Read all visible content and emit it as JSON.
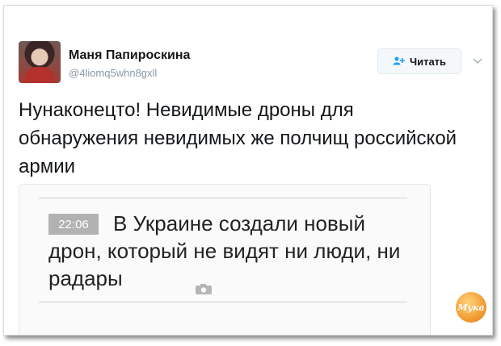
{
  "tweet": {
    "author_name": "Маня Папироскина",
    "author_handle": "@4liomq5whn8gxll",
    "follow_label": "Читать",
    "text": "Нунаконецто! Невидимые дроны для обнаружения невидимых же полчищ российской армии"
  },
  "card": {
    "time": "22:06",
    "headline": "В Украине создали новый дрон, который не видят ни люди, ни радары"
  },
  "watermark": {
    "label": "Мука"
  },
  "colors": {
    "follow_icon": "#1da1f2",
    "text": "#14171a",
    "handle": "#8899a6",
    "time_badge": "#b2b2b2"
  },
  "icons": {
    "follow": "person-plus-icon",
    "more": "chevron-down-icon",
    "photo": "camera-icon"
  }
}
